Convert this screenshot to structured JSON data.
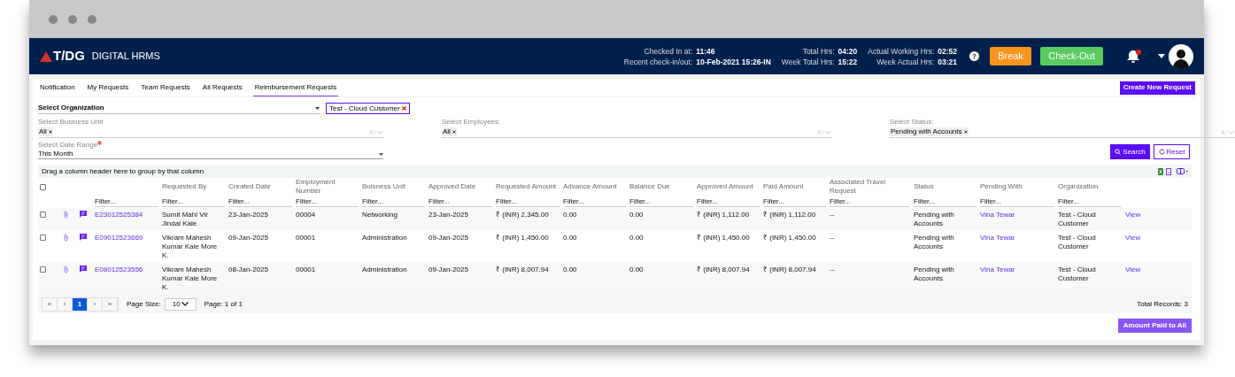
{
  "header": {
    "logo": "T/DG",
    "app_name": "DIGITAL HRMS",
    "stats": [
      {
        "label": "Checked In at:",
        "value": "11:46"
      },
      {
        "label": "Total Hrs:",
        "value": "04:20"
      },
      {
        "label": "Actual Working Hrs:",
        "value": "02:52"
      },
      {
        "label": "Recent check-in/out:",
        "value": "10-Feb-2021 15:26-IN"
      },
      {
        "label": "Week Total Hrs:",
        "value": "15:22"
      },
      {
        "label": "Week Actual Hrs:",
        "value": "03:21"
      }
    ],
    "help": "?",
    "buttons": [
      {
        "label": "Break",
        "kind": "break"
      },
      {
        "label": "Check-Out",
        "kind": "checkout"
      }
    ]
  },
  "tabs": [
    {
      "label": "Notification",
      "selected": false
    },
    {
      "label": "My Requests",
      "selected": false
    },
    {
      "label": "Team Requests",
      "selected": false
    },
    {
      "label": "All Requests",
      "selected": false
    },
    {
      "label": "Reimbursement Requests",
      "selected": true
    }
  ],
  "create_button": "Create New Request",
  "organization": {
    "label": "Select Organization",
    "tag": "Test - Cloud Customer"
  },
  "selects": [
    {
      "label": "Select Business Unit",
      "chips": [
        "All"
      ]
    },
    {
      "label": "Select Employees:",
      "chips": [
        "All"
      ]
    },
    {
      "label": "Select Status:",
      "chips": [
        "Pending with Accounts"
      ]
    }
  ],
  "date_range": {
    "label": "Select Date Range",
    "required": true,
    "value": "This Month"
  },
  "search_button": "Search",
  "reset_button": "Reset",
  "grid": {
    "group_hint": "Drag a column header here to group by that column",
    "select_all_checked": false,
    "columns": [
      {
        "kind": "link",
        "placeholder": "Filter..."
      },
      {
        "label": "Requested By",
        "placeholder": "Filter..."
      },
      {
        "label": "Created Date",
        "placeholder": "Filter..."
      },
      {
        "label": "Employment Number",
        "placeholder": "Filter..."
      },
      {
        "label": "Buisness Unit",
        "placeholder": "Filter..."
      },
      {
        "label": "Approved Date",
        "placeholder": "Filter..."
      },
      {
        "label": "Requested Amount",
        "placeholder": "Filter..."
      },
      {
        "label": "Advance Amount",
        "placeholder": "Filter..."
      },
      {
        "label": "Balance Due",
        "placeholder": "Filter..."
      },
      {
        "label": "Approved Amount",
        "placeholder": "Filter..."
      },
      {
        "label": "Paid Amount",
        "placeholder": "Filter..."
      },
      {
        "label": "Associated Travel Request",
        "placeholder": "Filter..."
      },
      {
        "label": "Status",
        "placeholder": "Filter..."
      },
      {
        "label": "Pending With",
        "kind": "link",
        "placeholder": "Filter..."
      },
      {
        "label": "Organization",
        "placeholder": "Filter..."
      },
      {
        "kind": "link"
      }
    ],
    "rows": [
      {
        "checked": false,
        "cells": [
          "E23012525384",
          "Sumit Mahi Vir Jindal Kale",
          "23-Jan-2025",
          "00004",
          "Networking",
          "23-Jan-2025",
          "₹ (INR) 2,345.00",
          "0.00",
          "0.00",
          "₹ (INR) 1,112.00",
          "₹ (INR) 1,112.00",
          "--",
          "Pending with Accounts",
          "Vina Tewar",
          "Test - Cloud Customer",
          "View"
        ]
      },
      {
        "checked": false,
        "cells": [
          "E09012523669",
          "Vikram Mahesh Kumar Kale More K.",
          "09-Jan-2025",
          "00001",
          "Administration",
          "09-Jan-2025",
          "₹ (INR) 1,450.00",
          "0.00",
          "0.00",
          "₹ (INR) 1,450.00",
          "₹ (INR) 1,450.00",
          "--",
          "Pending with Accounts",
          "Vina Tewar",
          "Test - Cloud Customer",
          "View"
        ]
      },
      {
        "checked": false,
        "cells": [
          "E08012523556",
          "Vikram Mahesh Kumar Kale More K.",
          "08-Jan-2025",
          "00001",
          "Administration",
          "09-Jan-2025",
          "₹ (INR) 8,007.94",
          "0.00",
          "0.00",
          "₹ (INR) 8,007.94",
          "₹ (INR) 8,007.94",
          "--",
          "Pending with Accounts",
          "Vina Tewar",
          "Test - Cloud Customer",
          "View"
        ]
      }
    ]
  },
  "pager": {
    "buttons": [
      {
        "label": "«",
        "selected": false
      },
      {
        "label": "‹",
        "selected": false
      },
      {
        "label": "1",
        "selected": true
      },
      {
        "label": "›",
        "selected": false
      },
      {
        "label": "»",
        "selected": false
      }
    ],
    "page_size_label": "Page Size:",
    "page_size": "10",
    "page_info": "Page: 1 of 1",
    "total": "Total Records: 3"
  },
  "footer_button": "Amount Paid to All"
}
